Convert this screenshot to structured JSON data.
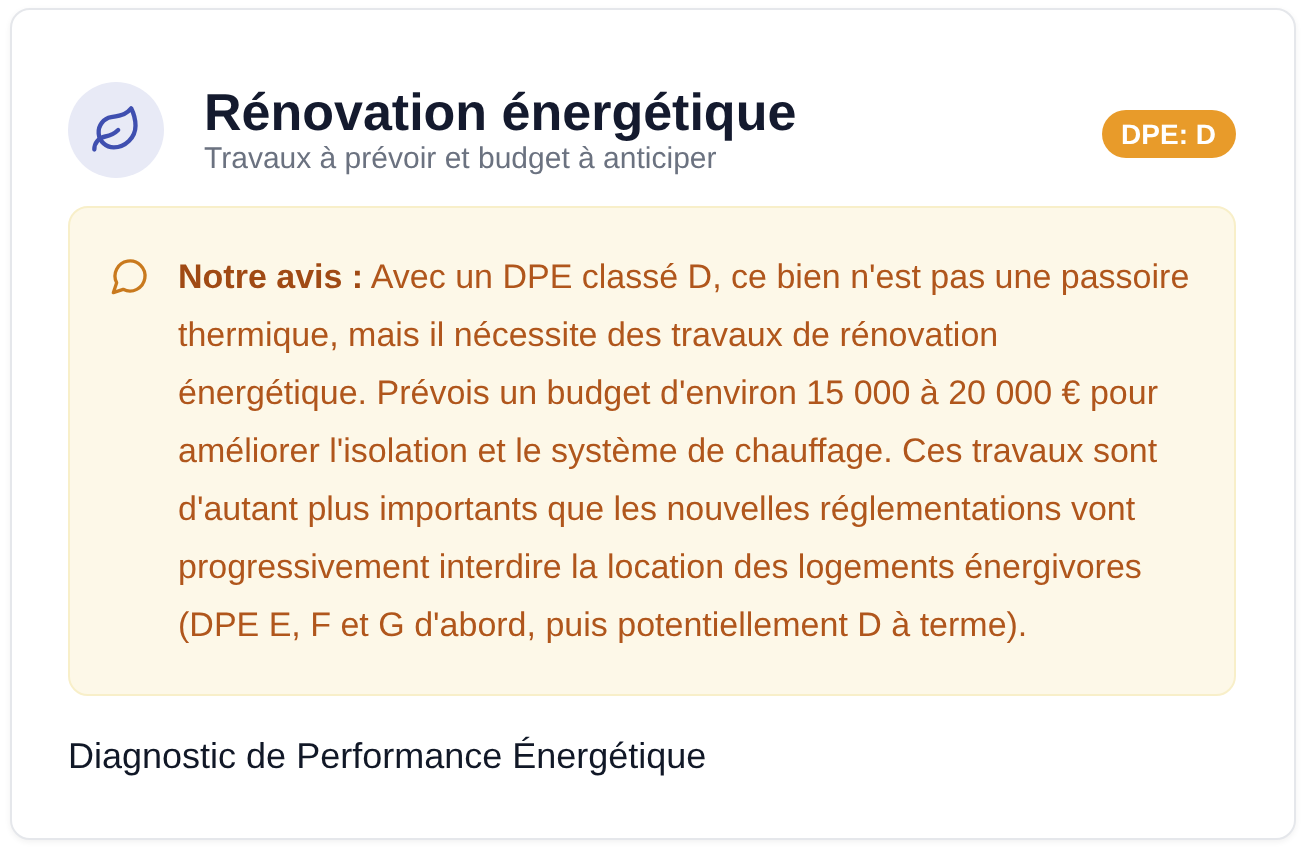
{
  "card": {
    "title": "Rénovation énergétique",
    "subtitle": "Travaux à prévoir et budget à anticiper",
    "badge": "DPE: D"
  },
  "advice": {
    "text": "**Notre avis :** Avec un DPE classé D, ce bien n'est pas une passoire thermique, mais il nécessite des travaux de rénovation énergétique. Prévois un budget d'environ 15 000 à 20 000 € pour améliorer l'isolation et le système de chauffage. Ces travaux sont d'autant plus importants que les nouvelles réglementations vont progressivement interdire la location des logements énergivores (DPE E, F et G d'abord, puis potentiellement D à terme)."
  },
  "section": {
    "heading": "Diagnostic de Performance Énergétique"
  }
}
